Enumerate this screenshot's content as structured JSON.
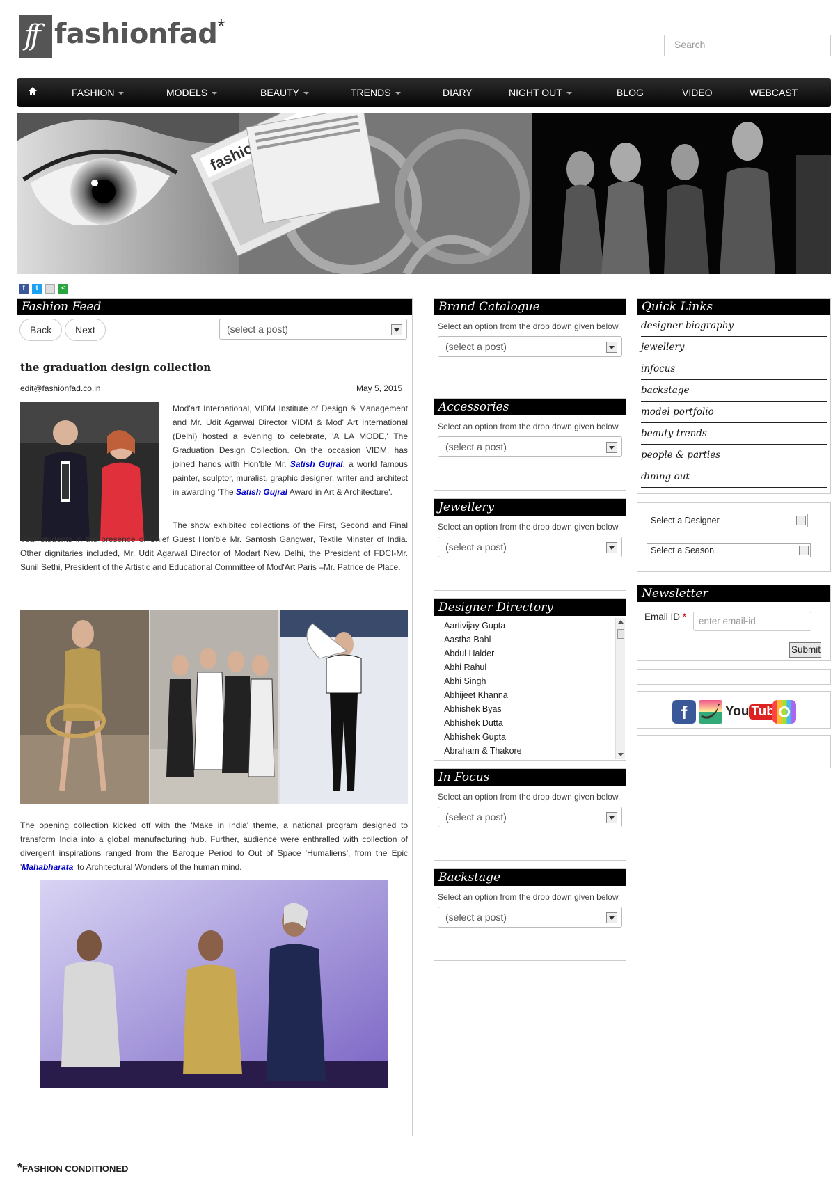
{
  "brand": {
    "name": "fashionfad",
    "star": "*",
    "mark": "ff"
  },
  "search": {
    "placeholder": "Search"
  },
  "nav": {
    "items": [
      {
        "label": "FASHION"
      },
      {
        "label": "MODELS"
      },
      {
        "label": "BEAUTY"
      },
      {
        "label": "TRENDS"
      },
      {
        "label": "DIARY"
      },
      {
        "label": "NIGHT OUT"
      },
      {
        "label": "BLOG"
      },
      {
        "label": "VIDEO"
      },
      {
        "label": "WEBCAST"
      }
    ]
  },
  "banner": {
    "newspaper_label": "fashionfad"
  },
  "feed": {
    "title": "Fashion Feed",
    "back_label": "Back",
    "next_label": "Next",
    "select_value": "(select a post)",
    "article": {
      "title": "the graduation design collection",
      "author": "edit@fashionfad.co.in",
      "date": "May 5, 2015",
      "p1_a": "Mod'art International, VIDM Institute of Design & Management and Mr. Udit Agarwal Director VIDM & Mod' Art International (Delhi) hosted a evening to celebrate, 'A LA MODE,' The Graduation Design Collection. On the occasion VIDM, has joined hands with Hon'ble Mr.",
      "p1_link1": "Satish Gujral",
      "p1_b": ", a world famous painter, sculptor, muralist, graphic designer, writer and architect in awarding 'The",
      "p1_link2": "Satish Gujral",
      "p1_c": "Award in Art & Architecture'.",
      "p2": "The show exhibited collections of the First, Second and Final Year students in the presence of Chief Guest Hon'ble Mr. Santosh Gangwar, Textile Minster of India. Other dignitaries included, Mr. Udit Agarwal Director of Modart New Delhi, the President of FDCI-Mr. Sunil Sethi, President of the Artistic and Educational Committee of Mod'Art Paris –Mr. Patrice de Place.",
      "p3_a": "The opening collection kicked off with the 'Make in India' theme, a national program designed to transform India into a global manufacturing hub. Further, audience were enthralled with collection of divergent inspirations ranged from the Baroque Period to Out of Space 'Humaliens', from the Epic '",
      "p3_link": "Mahabharata",
      "p3_b": "' to Architectural Wonders of the human mind."
    }
  },
  "middle": {
    "desc": "Select an option from the drop down given below.",
    "select_value": "(select a post)",
    "panels": [
      {
        "title": "Brand Catalogue"
      },
      {
        "title": "Accessories"
      },
      {
        "title": "Jewellery"
      },
      {
        "title": "In Focus"
      },
      {
        "title": "Backstage"
      }
    ],
    "designer_directory": {
      "title": "Designer Directory",
      "names": [
        "Aartivijay Gupta",
        "Aastha Bahl",
        "Abdul Halder",
        "Abhi Rahul",
        "Abhi Singh",
        "Abhijeet Khanna",
        "Abhishek Byas",
        "Abhishek Dutta",
        "Abhishek Gupta",
        "Abraham & Thakore"
      ]
    }
  },
  "right": {
    "quick_links": {
      "title": "Quick Links",
      "items": [
        "designer biography",
        "jewellery",
        "infocus",
        "backstage",
        "model portfolio",
        "beauty trends",
        "people & parties",
        "dining out"
      ]
    },
    "designer_select": "Select a Designer",
    "season_select": "Select a Season",
    "newsletter": {
      "title": "Newsletter",
      "email_label": "Email ID",
      "required_mark": "*",
      "email_placeholder": "enter email-id",
      "submit_label": "Submit"
    },
    "social": {
      "youtube_you": "You",
      "youtube_tube": "Tube"
    }
  },
  "footer": {
    "star": "*",
    "tagline": "FASHION CONDITIONED"
  }
}
